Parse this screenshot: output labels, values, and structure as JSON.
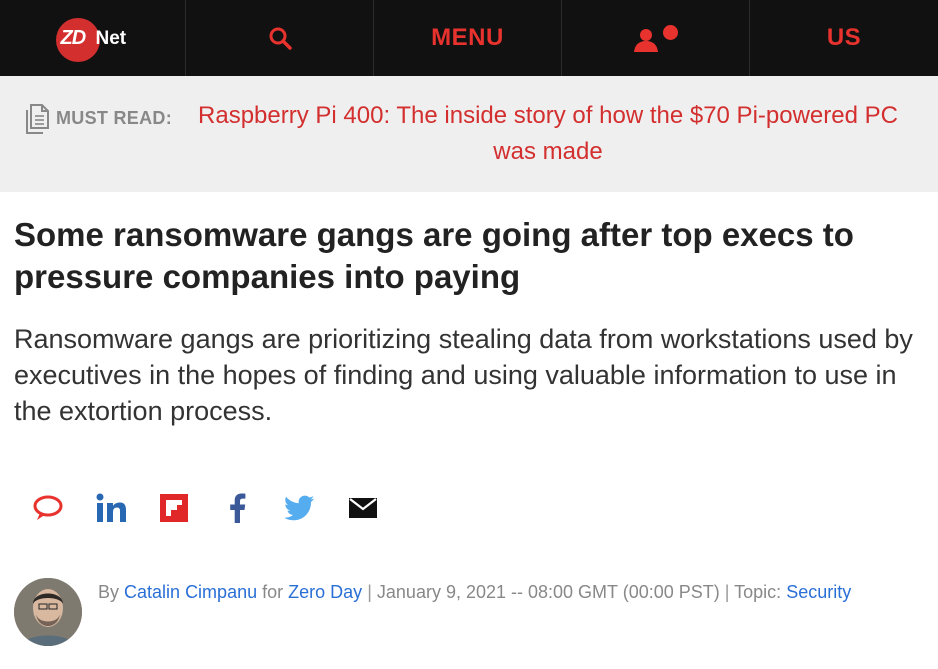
{
  "nav": {
    "logo_text": {
      "zd": "ZD",
      "net": "Net"
    },
    "menu_label": "MENU",
    "edition_label": "US",
    "colors": {
      "bar": "#111111",
      "accent": "#e7322e"
    },
    "icons": {
      "search": "search-icon",
      "user": "user-icon",
      "notification": "notification-dot"
    }
  },
  "must_read": {
    "label": "MUST READ:",
    "link_text": "Raspberry Pi 400: The inside story of how the $70 Pi-powered PC was made",
    "icon": "document-icon"
  },
  "article": {
    "headline": "Some ransomware gangs are going after top execs to pressure companies into paying",
    "dek": "Ransomware gangs are prioritizing stealing data from workstations used by executives in the hopes of finding and using valuable information to use in the extortion process."
  },
  "share": {
    "buttons": [
      "comment-icon",
      "linkedin-icon",
      "flipboard-icon",
      "facebook-icon",
      "twitter-icon",
      "email-icon"
    ]
  },
  "byline": {
    "by": "By",
    "author": "Catalin Cimpanu",
    "for": "for",
    "blog": "Zero Day",
    "separator": "|",
    "date": "January 9, 2021 -- 08:00 GMT (00:00 PST)",
    "topic_label": "Topic:",
    "topic": "Security"
  }
}
